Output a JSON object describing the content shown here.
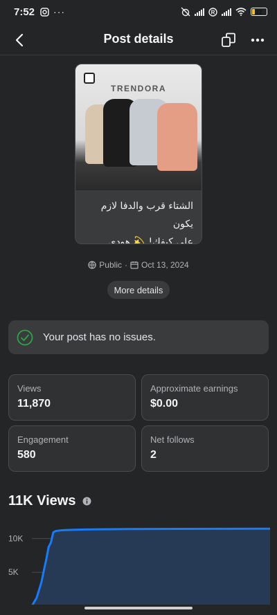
{
  "status_bar": {
    "time": "7:52",
    "battery": "22",
    "battery_level": 0.22
  },
  "header": {
    "title": "Post details"
  },
  "post": {
    "brand": "TRENDORA",
    "caption_line1": "الشتاء قرب والدفا لازم يكون",
    "caption_line2": "على كيفك! 💫 هودي ميلت..."
  },
  "meta": {
    "visibility": "Public",
    "separator": "·",
    "date": "Oct 13, 2024"
  },
  "more_details_label": "More details",
  "issues": {
    "message": "Your post has no issues."
  },
  "stats": [
    {
      "label": "Views",
      "value": "11,870"
    },
    {
      "label": "Approximate earnings",
      "value": "$0.00"
    },
    {
      "label": "Engagement",
      "value": "580"
    },
    {
      "label": "Net follows",
      "value": "2"
    }
  ],
  "views_section": {
    "title": "11K Views"
  },
  "chart_data": {
    "type": "area",
    "title": "11K Views",
    "yticks": [
      "10K",
      "5K"
    ],
    "ylim": [
      0,
      12500
    ],
    "x": [
      0,
      2,
      4,
      5,
      6,
      7,
      8,
      9,
      10,
      11,
      12,
      14,
      18,
      25,
      40,
      60,
      100
    ],
    "values": [
      0,
      1200,
      3500,
      5200,
      6800,
      8700,
      9400,
      10900,
      11100,
      11150,
      11200,
      11250,
      11300,
      11350,
      11400,
      11420,
      11450
    ],
    "xlim": [
      0,
      100
    ],
    "line_color": "#1a7cf5",
    "fill_color": "#263a55"
  },
  "colors": {
    "accent_green": "#31a24c",
    "background": "#242526"
  }
}
